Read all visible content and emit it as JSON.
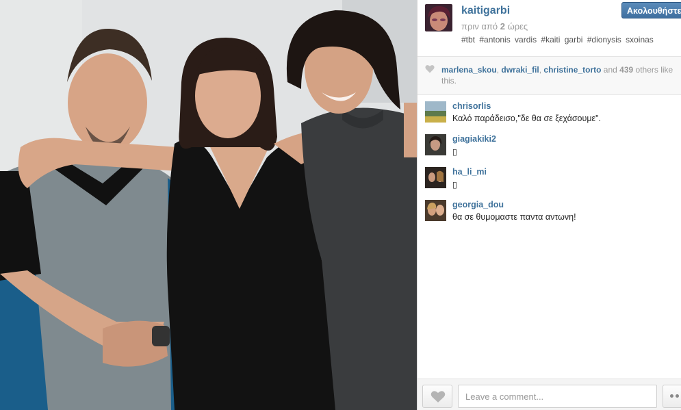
{
  "header": {
    "username": "kaitigarbi",
    "time_prefix": "πριν από",
    "time_number": "2",
    "time_unit": "ώρες",
    "caption": "#tbt #antonis vardis #kaiti garbi #dionysis sxoinas",
    "follow_label": "Ακολουθήστε"
  },
  "likes": {
    "users": [
      "marlena_skou",
      "dwraki_fil",
      "christine_torto"
    ],
    "and_word": "and",
    "others_count": "439",
    "others_text": "others like this."
  },
  "comments": [
    {
      "user": "chrisorlis",
      "text": "Καλό παράδεισο,\"δε θα σε ξεχάσουμε\"."
    },
    {
      "user": "giagiakiki2",
      "text": "▯"
    },
    {
      "user": "ha_li_mi",
      "text": "▯"
    },
    {
      "user": "georgia_dou",
      "text": "θα σε θυμομαστε παντα αντωνη!"
    }
  ],
  "footer": {
    "comment_placeholder": "Leave a comment..."
  },
  "icons": {
    "likes": "heart-icon",
    "like_button": "heart-icon",
    "more": "more-options-icon"
  },
  "colors": {
    "link": "#3f729b",
    "follow_button": "#4a7cad"
  }
}
